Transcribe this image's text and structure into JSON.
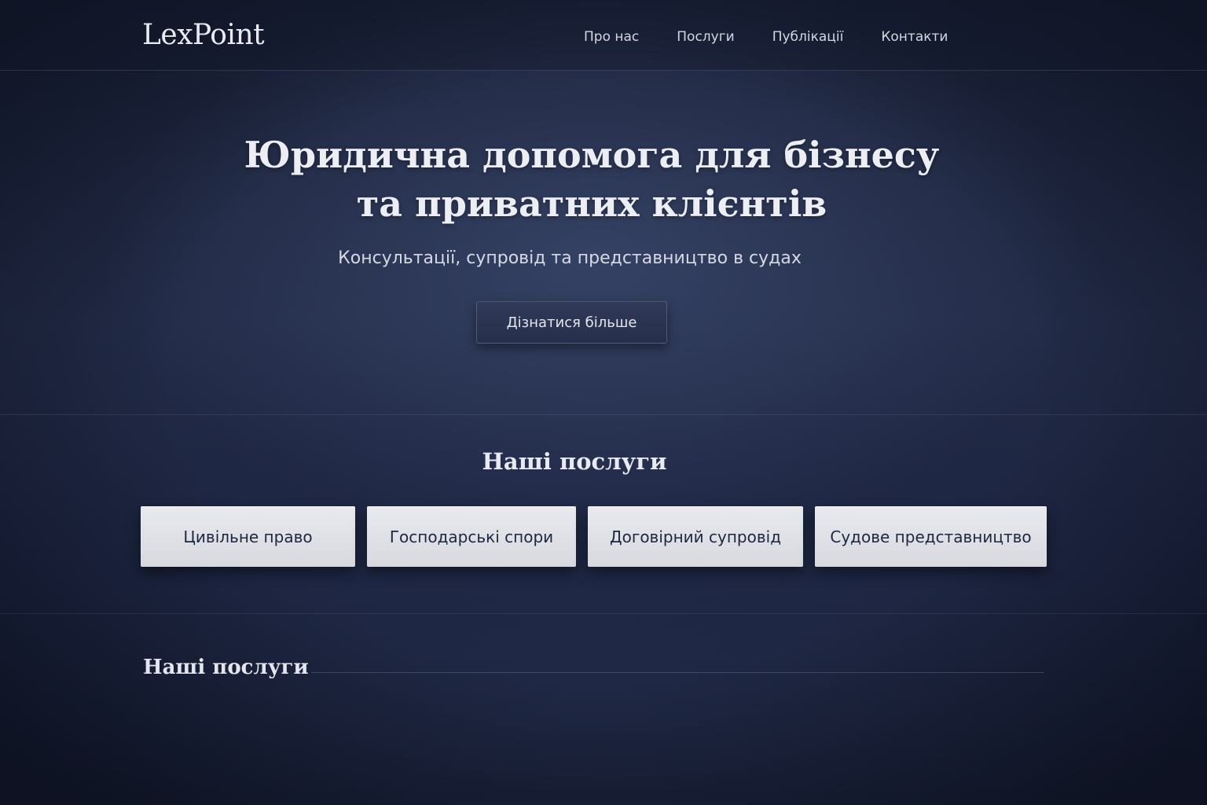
{
  "header": {
    "logo": "LexPoint",
    "nav": [
      "Про нас",
      "Послуги",
      "Публікації",
      "Контакти"
    ]
  },
  "hero": {
    "title_line1": "Юридична допомога для бізнесу",
    "title_line2": "та приватних клієнтів",
    "subtitle": "Консультації, супровід та представництво в судах",
    "cta_label": "Дізнатися більше"
  },
  "services": {
    "title": "Наші послуги",
    "cards": [
      "Цивільне право",
      "Господарські спори",
      "Договірний супровід",
      "Судове представництво"
    ]
  },
  "section2": {
    "title": "Наші послуги"
  }
}
